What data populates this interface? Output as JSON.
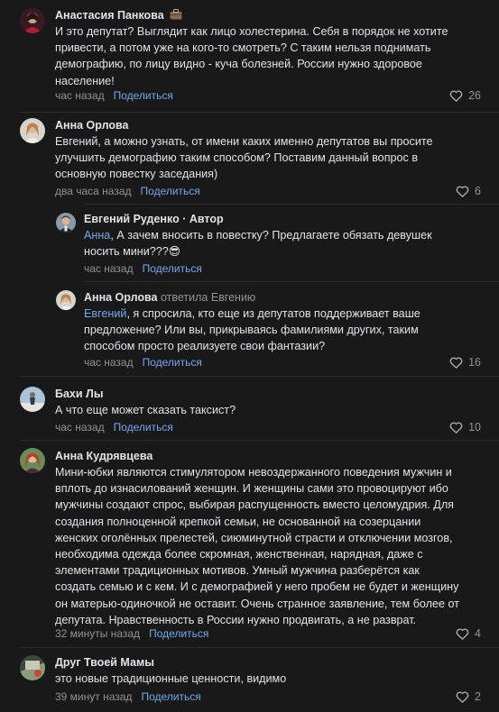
{
  "comments": [
    {
      "author": "Анастасия Панкова",
      "badge_icon": "briefcase-icon",
      "lines": [
        "И это депутат? Выглядит как лицо холестерина. Себя в порядок не хотите",
        "привести, а потом уже на кого-то смотреть? С таким нельзя поднимать",
        "демографию, по лицу видно - куча болезней. России нужно здоровое",
        "население!"
      ],
      "time": "час назад",
      "share": "Поделиться",
      "likes": "26"
    },
    {
      "author": "Анна Орлова",
      "lines": [
        "Евгений, а можно узнать, от имени каких именно депутатов вы просите",
        "улучшить демографию таким способом? Поставим данный вопрос в",
        "основную повестку заседания)"
      ],
      "time": "два часа назад",
      "share": "Поделиться",
      "likes": "6"
    },
    {
      "author": "Евгений Руденко",
      "role": " · Автор",
      "mention": "Анна",
      "lines": [
        ", А зачем вносить в повестку? Предлагаете обязать девушек",
        "носить мини???😎"
      ],
      "time": "час назад",
      "share": "Поделиться"
    },
    {
      "author": "Анна Орлова",
      "reply_to": " ответила Евгению",
      "mention": "Евгений",
      "lines": [
        ", я спросила, кто еще из депутатов поддерживает ваше",
        "предложение? Или вы, прикрываясь фамилиями других, таким",
        "способом просто реализуете свои фантазии?"
      ],
      "time": "час назад",
      "share": "Поделиться",
      "likes": "16"
    },
    {
      "author": "Бахи Лы",
      "lines": [
        "А что еще может сказать таксист?"
      ],
      "time": "час назад",
      "share": "Поделиться",
      "likes": "10"
    },
    {
      "author": "Анна Кудрявцева",
      "lines": [
        "Мини-юбки являются стимулятором невоздержанного поведения мужчин и",
        "вплоть до изнасилований женщин. И женщины сами это провоцируют ибо",
        "мужчины создают спрос, выбирая распущенность вместо целомудрия. Для",
        "создания полноценной крепкой семьи, не основанной на созерцании",
        "женских оголённых прелестей, сиюминутной страсти и отключении мозгов,",
        "необходима одежда более скромная, женственная, нарядная, даже с",
        "элементами традиционных мотивов. Умный мужчина разберётся как",
        "создать семью и с кем. И с демографией у него пробем не будет и женщину",
        "он матерью-одиночкой не оставит. Очень странное заявление, тем более от",
        "депутата. Нравственность в России нужно продвигать, а не разврат."
      ],
      "time": "32 минуты назад",
      "share": "Поделиться",
      "likes": "4"
    },
    {
      "author": "Друг Твоей Мамы",
      "lines": [
        "это новые традиционные ценности, видимо"
      ],
      "time": "39 минут назад",
      "share": "Поделиться",
      "likes": "2"
    }
  ],
  "colors": {
    "background": "#19191a",
    "text": "#e1e3e6",
    "secondary": "#939393",
    "link": "#71aaeb"
  }
}
